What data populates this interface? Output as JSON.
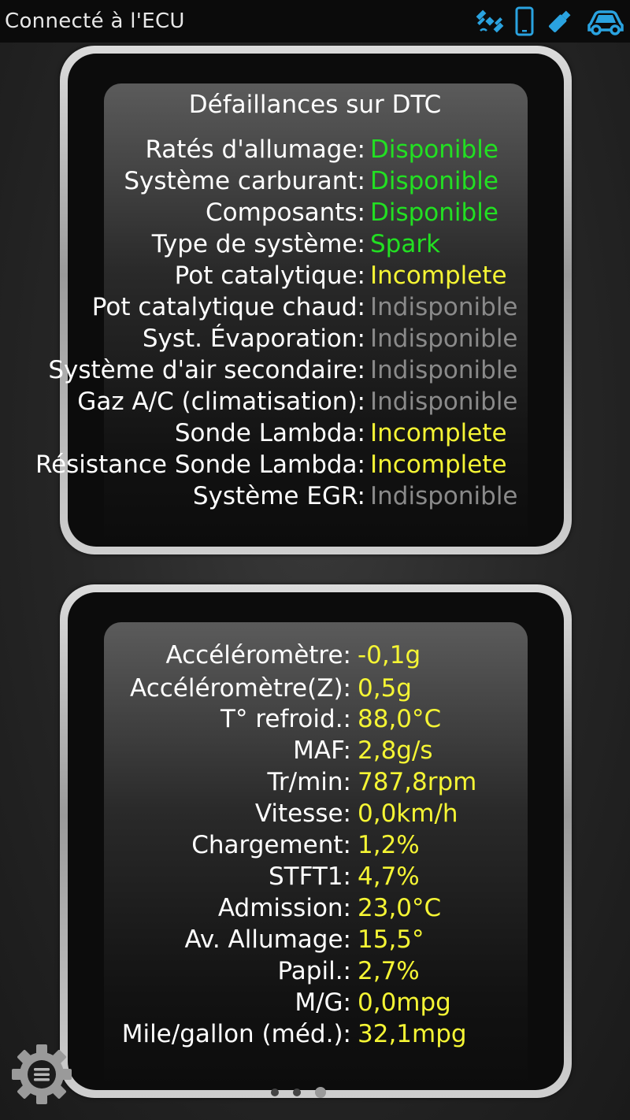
{
  "status_bar": {
    "title": "Connecté à l'ECU",
    "icons": [
      "satellite-icon",
      "phone-icon",
      "bluetooth-dongle-icon",
      "car-icon"
    ],
    "icon_color": "#2aa3e0"
  },
  "dtc_panel": {
    "title": "Défaillances sur DTC",
    "rows": [
      {
        "label": "Ratés d'allumage:",
        "value": "Disponible",
        "status": "available"
      },
      {
        "label": "Système carburant:",
        "value": "Disponible",
        "status": "available"
      },
      {
        "label": "Composants:",
        "value": "Disponible",
        "status": "available"
      },
      {
        "label": "Type de système:",
        "value": "Spark",
        "status": "available"
      },
      {
        "label": "Pot catalytique:",
        "value": "Incomplete",
        "status": "incomplete"
      },
      {
        "label": "Pot catalytique chaud:",
        "value": "Indisponible",
        "status": "unavailable"
      },
      {
        "label": "Syst. Évaporation:",
        "value": "Indisponible",
        "status": "unavailable"
      },
      {
        "label": "Système d'air secondaire:",
        "value": "Indisponible",
        "status": "unavailable"
      },
      {
        "label": "Gaz A/C (climatisation):",
        "value": "Indisponible",
        "status": "unavailable"
      },
      {
        "label": "Sonde Lambda:",
        "value": "Incomplete",
        "status": "incomplete"
      },
      {
        "label": "Résistance Sonde Lambda:",
        "value": "Incomplete",
        "status": "incomplete"
      },
      {
        "label": "Système EGR:",
        "value": "Indisponible",
        "status": "unavailable"
      }
    ],
    "colors": {
      "available": "#22e022",
      "incomplete": "#f5f534",
      "unavailable": "#8a8a8a"
    }
  },
  "sensor_panel": {
    "rows": [
      {
        "label": "Accéléromètre:",
        "value": "-0,1g"
      },
      {
        "label": "Accéléromètre(Z):",
        "value": "0,5g"
      },
      {
        "label": "T° refroid.:",
        "value": "88,0°C"
      },
      {
        "label": "MAF:",
        "value": "2,8g/s"
      },
      {
        "label": "Tr/min:",
        "value": "787,8rpm"
      },
      {
        "label": "Vitesse:",
        "value": "0,0km/h"
      },
      {
        "label": "Chargement:",
        "value": "1,2%"
      },
      {
        "label": "STFT1:",
        "value": "4,7%"
      },
      {
        "label": "Admission:",
        "value": "23,0°C"
      },
      {
        "label": "Av. Allumage:",
        "value": "15,5°"
      },
      {
        "label": "Papil.:",
        "value": "2,7%"
      },
      {
        "label": "M/G:",
        "value": "0,0mpg"
      },
      {
        "label": "Mile/gallon (méd.):",
        "value": "32,1mpg"
      }
    ]
  },
  "page_indicator": {
    "count": 3,
    "active": 3
  }
}
